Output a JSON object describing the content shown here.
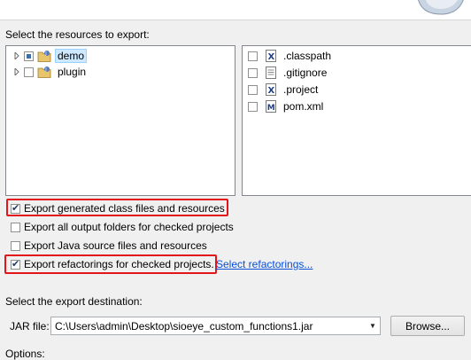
{
  "resources_label": "Select the resources to export:",
  "tree": {
    "items": [
      {
        "label": "demo",
        "state": "partial",
        "selected": true
      },
      {
        "label": "plugin",
        "state": "unchecked",
        "selected": false
      }
    ]
  },
  "files": [
    {
      "label": ".classpath",
      "icon": "xml-file-icon"
    },
    {
      "label": ".gitignore",
      "icon": "text-file-icon"
    },
    {
      "label": ".project",
      "icon": "xml-file-icon"
    },
    {
      "label": "pom.xml",
      "icon": "maven-pom-icon"
    }
  ],
  "options": {
    "export_class_files": {
      "label": "Export generated class files and resources",
      "checked": true
    },
    "export_output_folders": {
      "label": "Export all output folders for checked projects",
      "checked": false
    },
    "export_source": {
      "label": "Export Java source files and resources",
      "checked": false
    },
    "export_refactorings": {
      "label": "Export refactorings for checked projects.",
      "checked": true
    },
    "select_refactorings_link": "Select refactorings..."
  },
  "destination": {
    "label": "Select the export destination:",
    "jar_label": "JAR file:",
    "jar_path": "C:\\Users\\admin\\Desktop\\sioeye_custom_functions1.jar",
    "browse_label": "Browse..."
  },
  "options_heading": "Options:",
  "colors": {
    "highlight": "#e4141b",
    "link": "#0a4fd6",
    "selection": "#cde8ff"
  }
}
